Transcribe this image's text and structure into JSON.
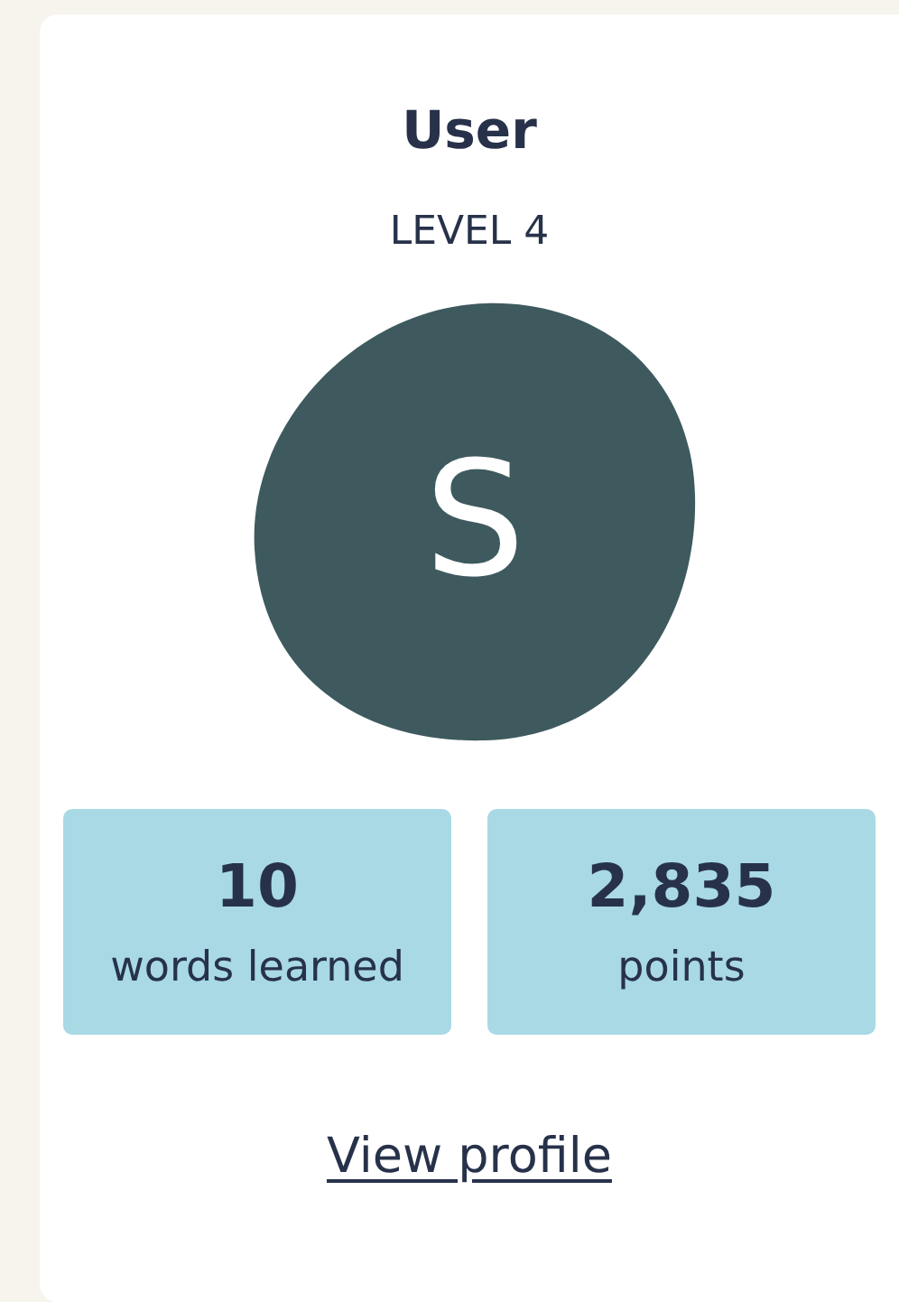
{
  "user": {
    "name": "User",
    "level": "LEVEL 4",
    "avatar_initial": "S"
  },
  "stats": [
    {
      "value": "10",
      "label": "words learned"
    },
    {
      "value": "2,835",
      "label": "points"
    }
  ],
  "link": "View profile"
}
